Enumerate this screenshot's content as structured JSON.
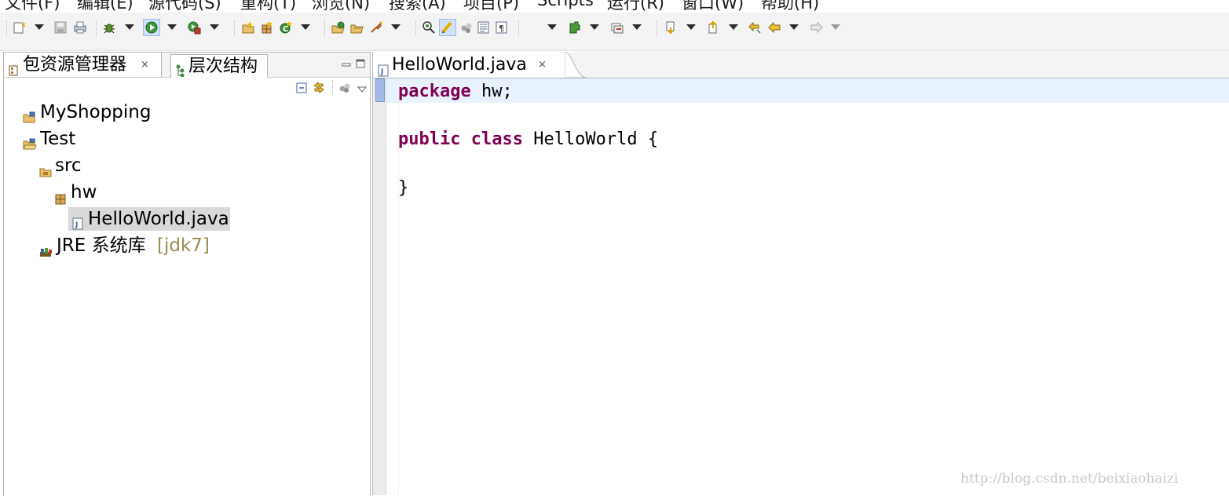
{
  "menu": [
    "文件(F)",
    "编辑(E)",
    "源代码(S)",
    "重构(T)",
    "浏览(N)",
    "搜索(A)",
    "项目(P)",
    "Scripts",
    "运行(R)",
    "窗口(W)",
    "帮助(H)"
  ],
  "toolbar": {
    "icons": [
      "new-wizard-icon",
      "save-icon",
      "print-icon",
      "debug-icon",
      "run-icon",
      "external-tools-icon",
      "new-java-project-icon",
      "new-package-icon",
      "new-class-icon",
      "open-type-icon",
      "open-task-icon",
      "search-icon",
      "toggle-breadcrumb-icon",
      "mark-occurrences-icon",
      "block-selection-icon",
      "toggle-word-wrap-icon",
      "show-whitespace-icon",
      "next-annotation-icon",
      "previous-annotation-icon",
      "last-edit-location-icon",
      "back-icon",
      "forward-icon"
    ]
  },
  "left_view": {
    "tabs": [
      {
        "label": "包资源管理器",
        "close": "×"
      },
      {
        "label": "层次结构"
      }
    ],
    "tree": [
      {
        "label": "MyShopping"
      },
      {
        "label": "Test"
      },
      {
        "label": "src"
      },
      {
        "label": "hw"
      },
      {
        "label": "HelloWorld.java"
      },
      {
        "label": "JRE 系统库",
        "decoration": "[jdk7]"
      }
    ]
  },
  "editor": {
    "tab": {
      "label": "HelloWorld.java",
      "close": "×"
    },
    "lines": [
      {
        "kw": "package",
        "rest": " hw;"
      },
      {
        "kw": "",
        "rest": ""
      },
      {
        "kw": "public class",
        "rest": " HelloWorld {"
      },
      {
        "kw": "",
        "rest": ""
      },
      {
        "kw": "",
        "rest": "}"
      }
    ]
  },
  "watermark": "http://blog.csdn.net/beixiaohaizi",
  "colors": {
    "keyword": "#7f0055",
    "current_line": "#e8f2fe",
    "selection": "#d9d9d9",
    "decoration": "#9c8b4e"
  }
}
